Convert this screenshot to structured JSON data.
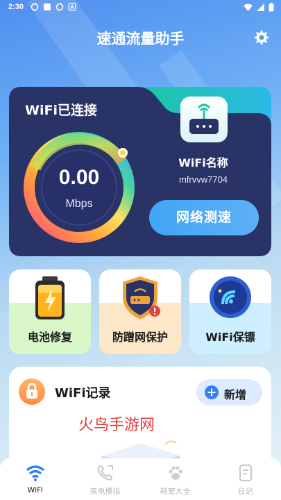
{
  "status_bar": {
    "time": "2:30"
  },
  "header": {
    "title": "速通流量助手"
  },
  "wifi_card": {
    "status_title": "WiFi已连接",
    "speed_value": "0.00",
    "speed_unit": "Mbps",
    "name_label": "WiFi名称",
    "ssid": "mfrvvw7704",
    "speedtest_label": "网络测速"
  },
  "features": [
    {
      "label": "电池修复",
      "icon": "battery-icon",
      "tint": "#d9f6c9"
    },
    {
      "label": "防蹭网保护",
      "icon": "router-shield-icon",
      "tint": "#fde7c8"
    },
    {
      "label": "WiFi保镖",
      "icon": "wifi-badge-icon",
      "tint": "#cdefff"
    }
  ],
  "records": {
    "title": "WiFi记录",
    "add_label": "新增",
    "watermark": "火鸟手游网"
  },
  "tabs": [
    {
      "label": "WiFi",
      "icon": "wifi-icon",
      "active": true
    },
    {
      "label": "来电模拟",
      "icon": "phone-icon",
      "active": false
    },
    {
      "label": "萌宠大全",
      "icon": "paw-icon",
      "active": false
    },
    {
      "label": "日记",
      "icon": "notebook-icon",
      "active": false
    }
  ],
  "colors": {
    "accent": "#42a5f5",
    "card_dark": "#2a3366",
    "card_teal": "#21c4a5",
    "record_orange": "#ff8a3d"
  }
}
